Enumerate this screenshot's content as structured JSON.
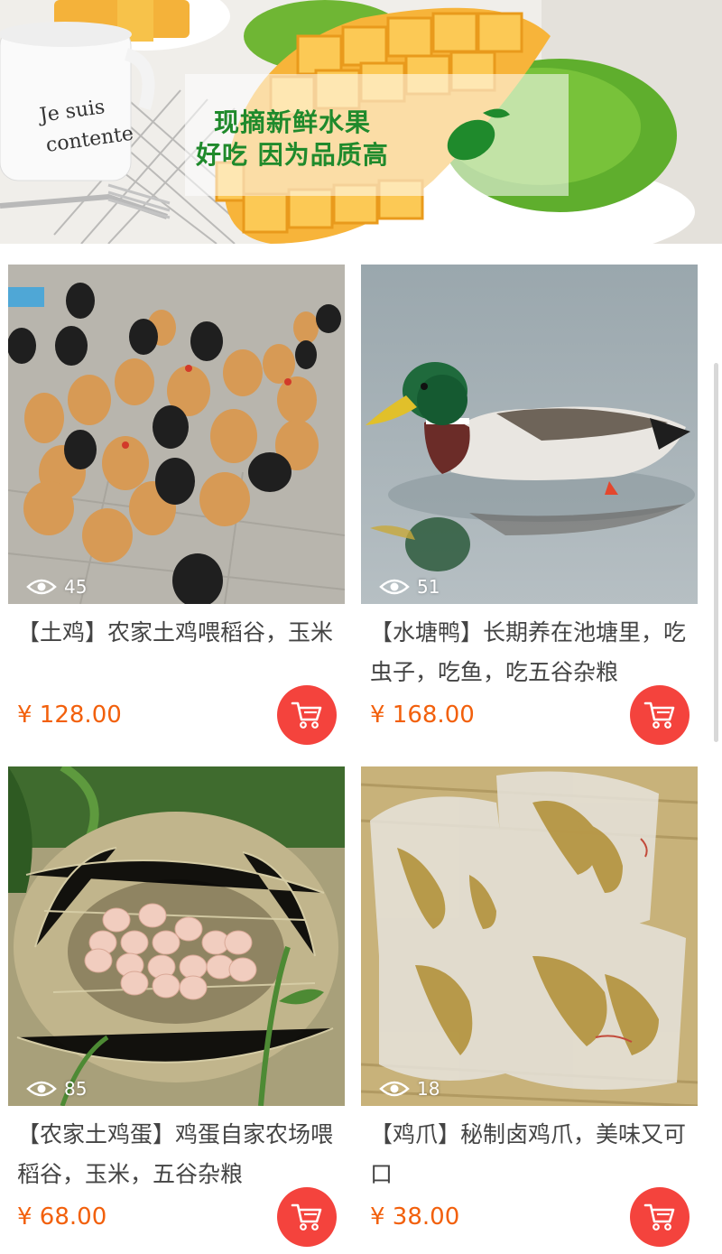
{
  "banner": {
    "line1": "现摘新鲜水果",
    "line2": "好吃 因为品质高",
    "cup_text": "Je suis contente"
  },
  "colors": {
    "price": "#f2600c",
    "cart_button": "#f4433d",
    "banner_green": "#1f8a2c"
  },
  "products": [
    {
      "views": "45",
      "title": "【土鸡】农家土鸡喂稻谷，玉米",
      "price": "¥ 128.00",
      "image": "chickens-flock"
    },
    {
      "views": "51",
      "title": "【水塘鸭】长期养在池塘里，吃虫子，吃鱼，吃五谷杂粮",
      "price": "¥ 168.00",
      "image": "mallard-duck"
    },
    {
      "views": "85",
      "title": "【农家土鸡蛋】鸡蛋自家农场喂稻谷，玉米，五谷杂粮",
      "price": "¥ 68.00",
      "image": "eggs-in-nest"
    },
    {
      "views": "18",
      "title": "【鸡爪】秘制卤鸡爪，美味又可口",
      "price": "¥ 38.00",
      "image": "packaged-chicken-feet"
    }
  ]
}
